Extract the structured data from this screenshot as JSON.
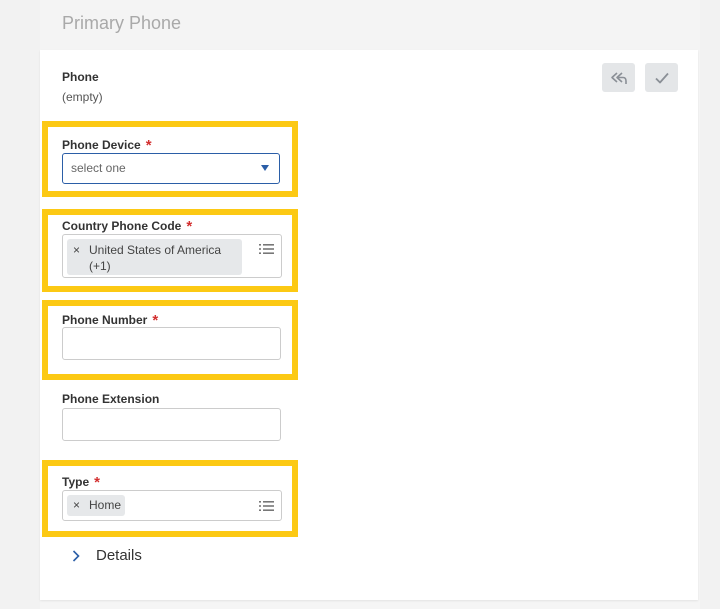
{
  "header": {
    "title": "Primary Phone"
  },
  "phone": {
    "label": "Phone",
    "value": "(empty)"
  },
  "actions": {
    "revert_icon": "undo-arrow-icon",
    "confirm_icon": "check-icon"
  },
  "phone_device": {
    "label": "Phone Device",
    "required_mark": "*",
    "value": "select one"
  },
  "country_code": {
    "label": "Country Phone Code",
    "required_mark": "*",
    "chip_remove": "×",
    "chip_line1": "United States of America",
    "chip_line2": "(+1)"
  },
  "phone_number": {
    "label": "Phone Number",
    "required_mark": "*",
    "value": ""
  },
  "extension": {
    "label": "Phone Extension",
    "value": ""
  },
  "type": {
    "label": "Type",
    "required_mark": "*",
    "chip_remove": "×",
    "chip": "Home"
  },
  "details": {
    "label": "Details"
  },
  "colors": {
    "highlight": "#fcc914",
    "required": "#d32f2f",
    "accent": "#2b5ea7"
  }
}
